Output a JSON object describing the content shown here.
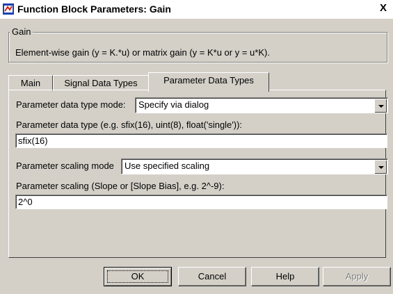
{
  "window": {
    "title": "Function Block Parameters: Gain",
    "close_glyph": "X"
  },
  "group": {
    "legend": "Gain",
    "description": "Element-wise gain (y = K.*u) or matrix gain (y = K*u or y = u*K)."
  },
  "tabs": [
    {
      "label": "Main",
      "active": false
    },
    {
      "label": "Signal Data Types",
      "active": false
    },
    {
      "label": "Parameter Data Types",
      "active": true
    }
  ],
  "params": {
    "mode_label": "Parameter data type mode:",
    "mode_value": "Specify via dialog",
    "type_label": "Parameter data type (e.g. sfix(16), uint(8), float('single')):",
    "type_value": "sfix(16)",
    "scaling_mode_label": "Parameter scaling mode",
    "scaling_mode_value": "Use specified scaling",
    "scaling_label": "Parameter scaling (Slope or [Slope Bias], e.g. 2^-9):",
    "scaling_value": "2^0"
  },
  "buttons": {
    "ok": "OK",
    "cancel": "Cancel",
    "help": "Help",
    "apply": "Apply"
  },
  "colors": {
    "dialog_bg": "#d4d0c8",
    "icon_blue": "#1a3fb0",
    "icon_red": "#d02010"
  }
}
